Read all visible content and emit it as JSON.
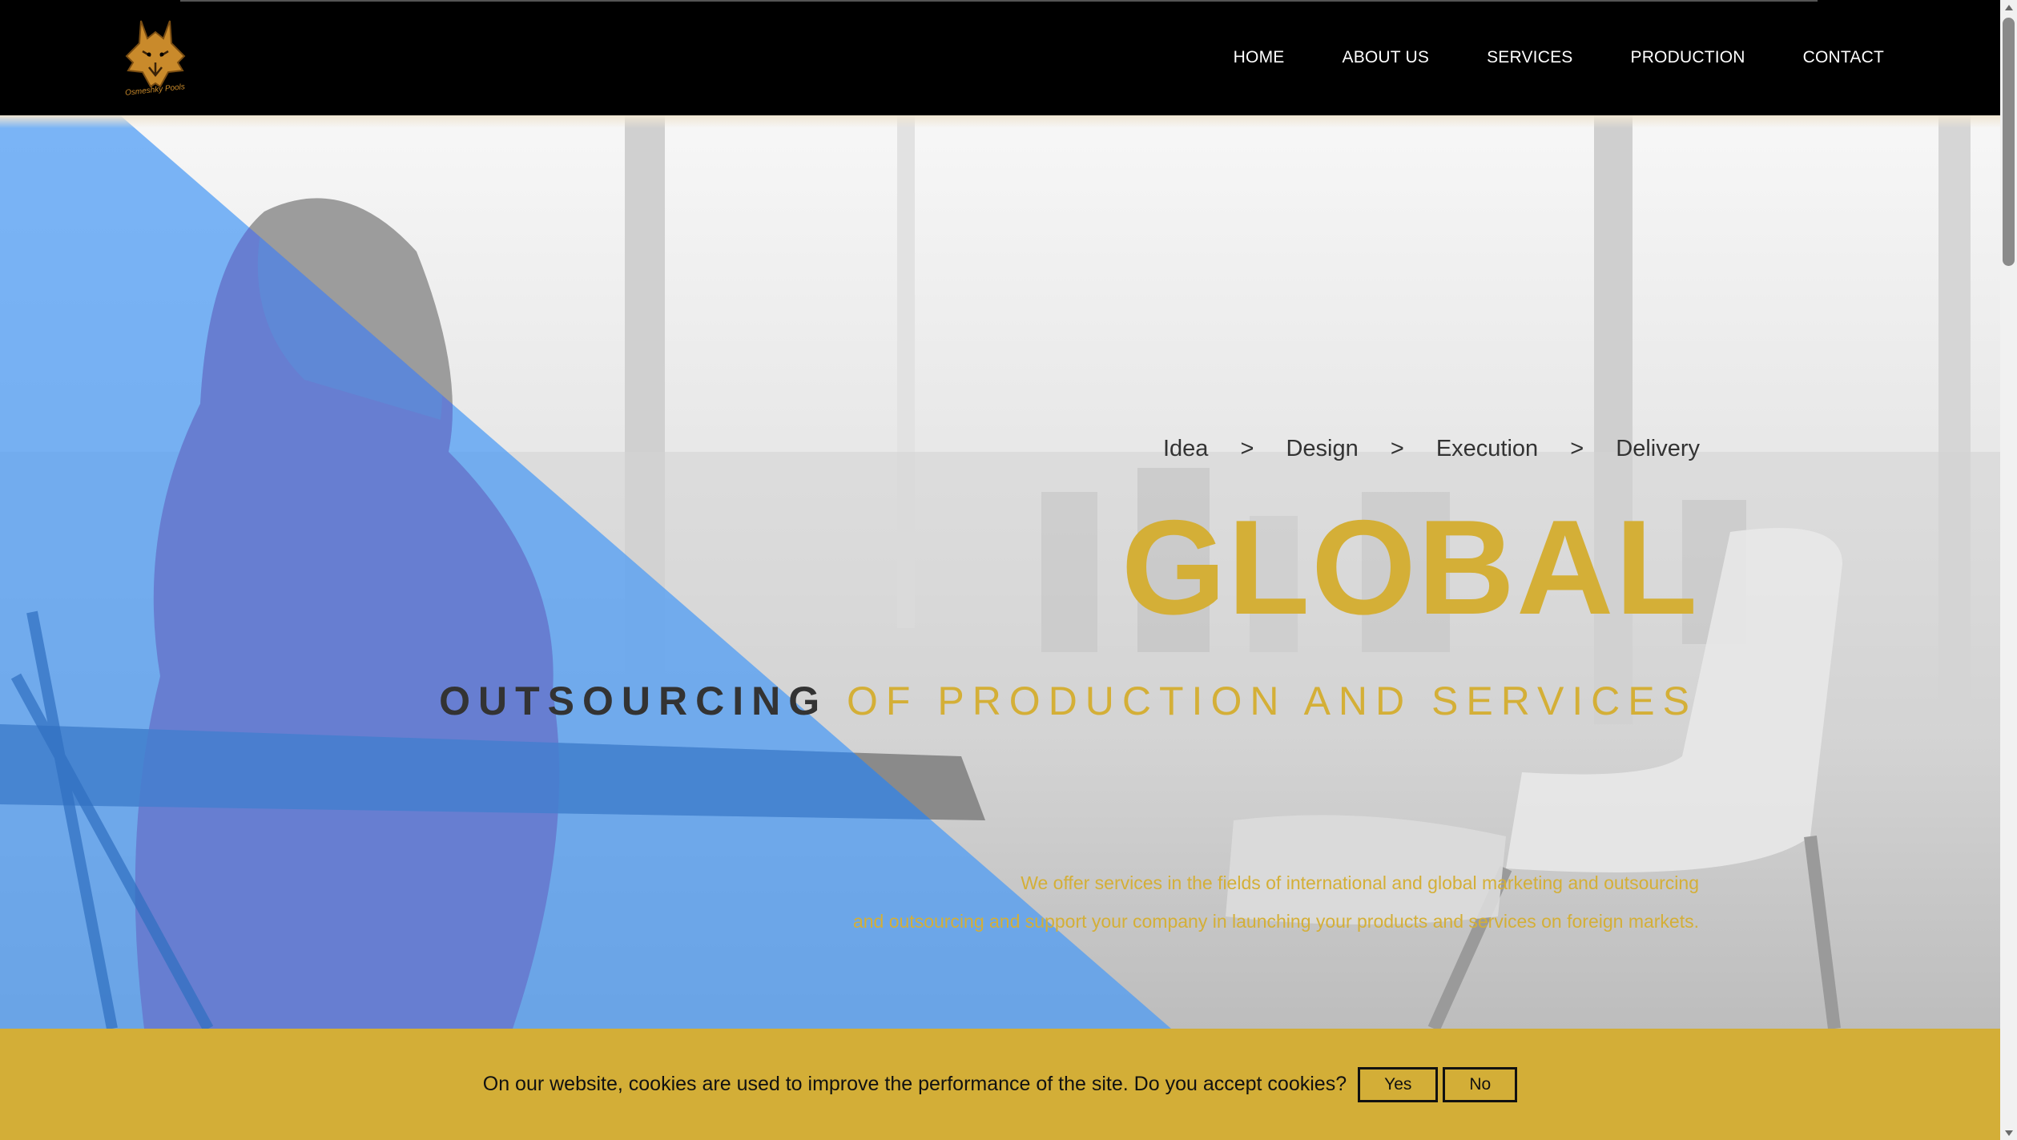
{
  "brand": {
    "logo_text": "Osmeshky Pools",
    "logo_color": "#c98a2b"
  },
  "nav": {
    "items": [
      {
        "label": "HOME"
      },
      {
        "label": "ABOUT US"
      },
      {
        "label": "SERVICES"
      },
      {
        "label": "PRODUCTION"
      },
      {
        "label": "CONTACT"
      }
    ]
  },
  "hero": {
    "steps": [
      "Idea",
      "Design",
      "Execution",
      "Delivery"
    ],
    "step_separator": ">",
    "headline": "GLOBAL",
    "subtitle_dark": "OUTSOURCING",
    "subtitle_gold": "OF PRODUCTION AND SERVICES",
    "description_line1": "We offer services in the fields of international and global marketing and outsourcing",
    "description_line2": "and outsourcing and support your company in launching your products and services on foreign markets."
  },
  "cookie": {
    "message": "On our website, cookies are used to improve the performance of the site. Do you accept cookies?",
    "accept_label": "Yes",
    "decline_label": "No"
  },
  "colors": {
    "gold": "#d4af37",
    "cookie_bar": "#d3ae37",
    "overlay_blue": "#4a9af5",
    "header": "#000000"
  }
}
